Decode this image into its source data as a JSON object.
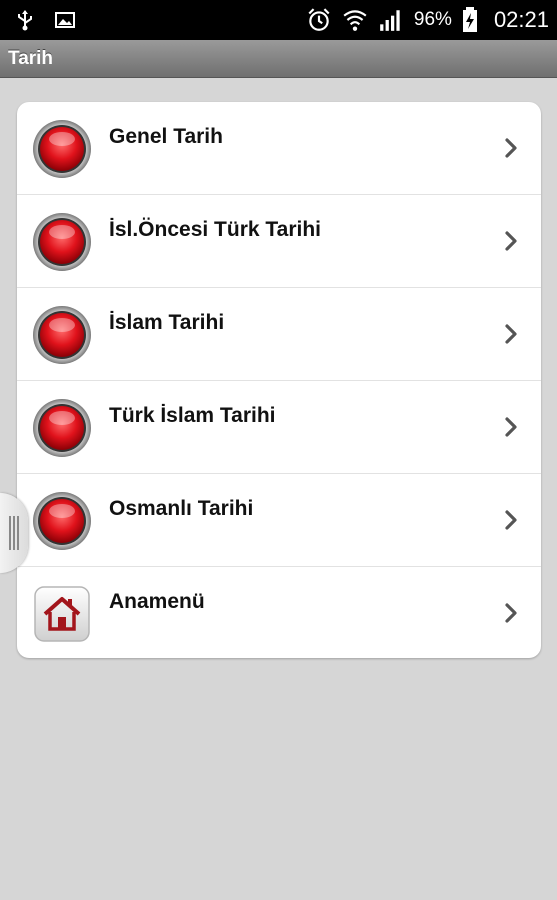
{
  "status_bar": {
    "icons_left": [
      "usb-icon",
      "image-icon"
    ],
    "icons_right": [
      "alarm-icon",
      "wifi-icon",
      "signal-icon",
      "battery-icon"
    ],
    "battery_percent": "96%",
    "time": "02:21"
  },
  "title_bar": {
    "title": "Tarih"
  },
  "menu": {
    "items": [
      {
        "label": "Genel Tarih",
        "icon": "red-button-icon"
      },
      {
        "label": "İsl.Öncesi Türk Tarihi",
        "icon": "red-button-icon"
      },
      {
        "label": "İslam Tarihi",
        "icon": "red-button-icon"
      },
      {
        "label": "Türk İslam Tarihi",
        "icon": "red-button-icon"
      },
      {
        "label": "Osmanlı Tarihi",
        "icon": "red-button-icon"
      },
      {
        "label": "Anamenü",
        "icon": "home-icon"
      }
    ]
  },
  "colors": {
    "background": "#d6d6d6",
    "card": "#ffffff",
    "accent_red": "#e0121b",
    "title_bar": "#8a8a8a"
  }
}
